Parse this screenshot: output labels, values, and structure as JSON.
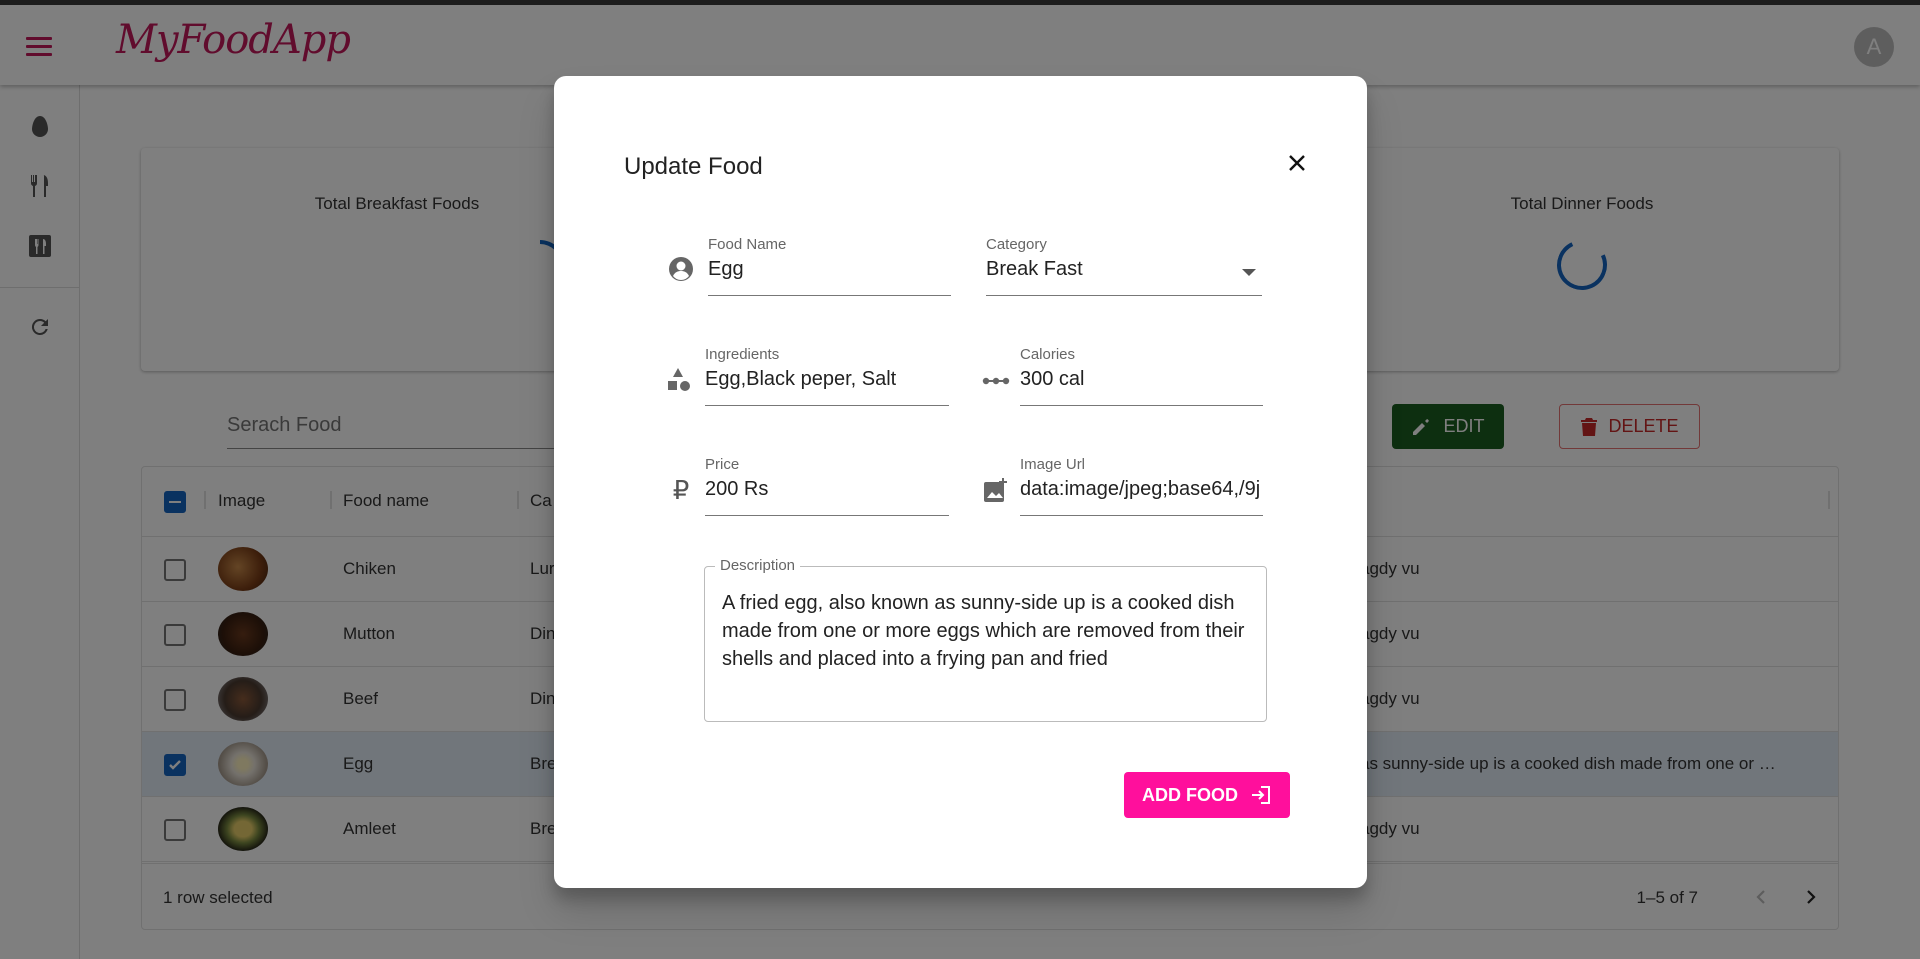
{
  "app": {
    "brand": "MyFoodApp",
    "avatar_letter": "A"
  },
  "sidebar": {
    "items": [
      {
        "icon": "egg-icon"
      },
      {
        "icon": "fork-knife-icon"
      },
      {
        "icon": "restaurant-icon"
      },
      {
        "icon": "refresh-icon"
      }
    ]
  },
  "stats": {
    "breakfast_label": "Total Breakfast Foods",
    "dinner_label": "Total Dinner Foods"
  },
  "search": {
    "placeholder": "Serach Food"
  },
  "toolbar": {
    "edit_label": "EDIT",
    "delete_label": "DELETE"
  },
  "grid": {
    "columns": [
      "Image",
      "Food name",
      "Ca"
    ],
    "rows": [
      {
        "name": "Chiken",
        "category": "Lur",
        "description": "agdy vu",
        "checked": false
      },
      {
        "name": "Mutton",
        "category": "Din",
        "description": "agdy vu",
        "checked": false
      },
      {
        "name": "Beef",
        "category": "Din",
        "description": "agdy vu",
        "checked": false
      },
      {
        "name": "Egg",
        "category": "Bre",
        "description": "as sunny-side up is a cooked dish made from one or …",
        "checked": true
      },
      {
        "name": "Amleet",
        "category": "Bre",
        "description": "agdy vu",
        "checked": false
      }
    ],
    "footer": {
      "selected_text": "1 row selected",
      "pagination": "1–5 of 7"
    }
  },
  "dialog": {
    "title": "Update Food",
    "fields": {
      "food_name": {
        "label": "Food Name",
        "value": "Egg"
      },
      "category": {
        "label": "Category",
        "value": "Break Fast"
      },
      "ingredients": {
        "label": "Ingredients",
        "value": "Egg,Black peper, Salt"
      },
      "calories": {
        "label": "Calories",
        "value": "300 cal"
      },
      "price": {
        "label": "Price",
        "value": "200 Rs"
      },
      "image_url": {
        "label": "Image Url",
        "value": "data:image/jpeg;base64,/9j"
      },
      "description": {
        "label": "Description",
        "value": "A fried egg, also known as sunny-side up is a cooked dish made from one or more eggs which are removed from their shells and placed into a frying pan and fried"
      }
    },
    "submit_label": "ADD FOOD"
  },
  "colors": {
    "brand": "#c2185b",
    "primary": "#1565c0",
    "edit_green": "#1b5e20",
    "delete_red": "#c62828",
    "add_pink": "#ff0f9c"
  }
}
